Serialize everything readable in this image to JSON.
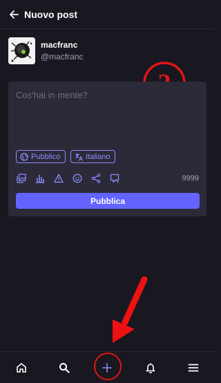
{
  "header": {
    "title": "Nuovo post",
    "back_icon": "arrow-left-icon"
  },
  "account": {
    "display_name": "macfranc",
    "username": "@macfranc"
  },
  "compose": {
    "placeholder": "Cos'hai in mente?",
    "visibility_label": "Pubblico",
    "language_label": "Italiano",
    "char_count": "9999",
    "publish_label": "Pubblica",
    "toolbar_icons": [
      "media-icon",
      "poll-icon",
      "warning-icon",
      "emoji-icon",
      "share-icon",
      "quote-icon"
    ]
  },
  "annotations": {
    "step_number": "2"
  },
  "bottom_nav": {
    "items": [
      "home-icon",
      "search-icon",
      "plus-icon",
      "bell-icon",
      "menu-icon"
    ]
  },
  "colors": {
    "background": "#191720",
    "card": "#2c2a38",
    "accent": "#6364ff",
    "pill": "#8c8dff",
    "annotation_red": "#e01515"
  }
}
